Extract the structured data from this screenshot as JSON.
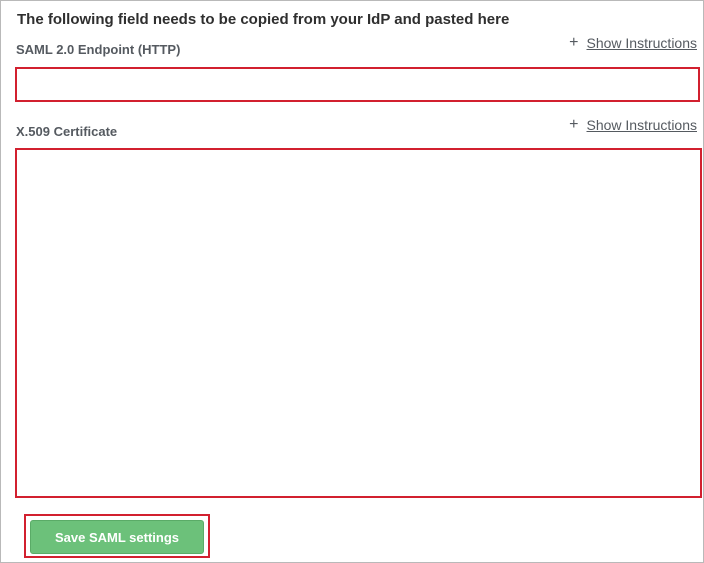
{
  "heading": "The following field needs to be copied from your IdP and pasted here",
  "saml_endpoint": {
    "label": "SAML 2.0 Endpoint (HTTP)",
    "show_instructions": "Show Instructions",
    "value": "",
    "icon": "plus-icon"
  },
  "certificate": {
    "label": "X.509 Certificate",
    "show_instructions": "Show Instructions",
    "value": "",
    "icon": "plus-icon"
  },
  "save_button": {
    "label": "Save SAML settings"
  },
  "colors": {
    "highlight": "#d2202f",
    "button": "#6cc17a",
    "text": "#555a60"
  }
}
